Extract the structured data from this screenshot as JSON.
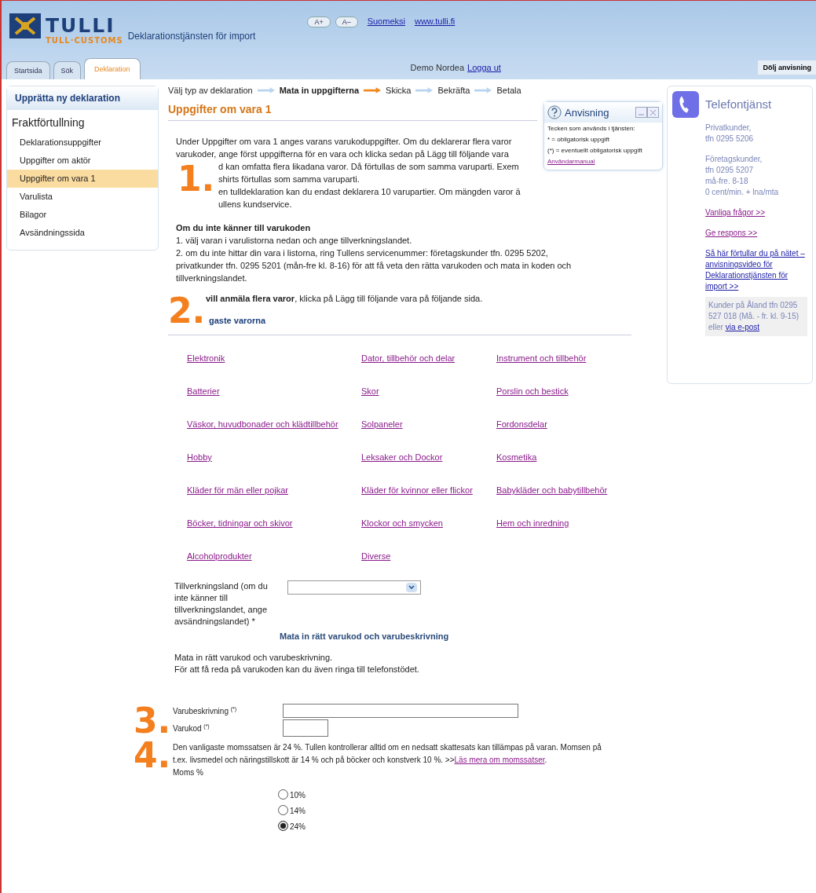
{
  "header": {
    "brand": "TULLI",
    "subbrand": "TULL·CUSTOMS",
    "service": "Deklarationstjänsten för import",
    "font_buttons": [
      "A+",
      "A–"
    ],
    "links": [
      "Suomeksi",
      "www.tulli.fi"
    ]
  },
  "tabs": [
    {
      "label": "Startsida",
      "selected": false
    },
    {
      "label": "Sök",
      "selected": false
    },
    {
      "label": "Deklaration",
      "selected": true
    }
  ],
  "user": {
    "name": "Demo Nordea",
    "logout": "Logga ut"
  },
  "hide_help": "Dölj anvisning",
  "sidebar": {
    "heading": "Upprätta ny deklaration",
    "group": "Fraktförtullning",
    "items": [
      {
        "label": "Deklarationsuppgifter",
        "selected": false
      },
      {
        "label": "Uppgifter om aktör",
        "selected": false
      },
      {
        "label": "Uppgifter om vara 1",
        "selected": true
      },
      {
        "label": "Varulista",
        "selected": false
      },
      {
        "label": "Bilagor",
        "selected": false
      },
      {
        "label": "Avsändningssida",
        "selected": false
      }
    ]
  },
  "steps": [
    {
      "label": "Välj typ av deklaration",
      "selected": false
    },
    {
      "label": "Mata in uppgifterna",
      "selected": true
    },
    {
      "label": "Skicka",
      "selected": false
    },
    {
      "label": "Bekräfta",
      "selected": false
    },
    {
      "label": "Betala",
      "selected": false
    }
  ],
  "title": "Uppgifter om vara 1",
  "intro_lines": [
    {
      "text": "Under Uppgifter om vara 1 anges varans varukoduppgifter. Om du deklarerar flera varor",
      "kind": "full"
    },
    {
      "text": "varukoder, ange först uppgifterna för en vara och klicka sedan på Lägg till följande vara",
      "kind": "full"
    },
    {
      "text": "d kan omfatta flera likadana varor. Då förtullas de som samma varuparti. Exem",
      "kind": "partial"
    },
    {
      "text": "shirts förtullas som samma varuparti.",
      "kind": "partial"
    },
    {
      "text": "en tulldeklaration kan du endast deklarera 10 varupartier. Om mängden varor ä",
      "kind": "partial"
    },
    {
      "text": "ullens kundservice.",
      "kind": "partial"
    }
  ],
  "markers": [
    "1.",
    "2.",
    "3.",
    "4."
  ],
  "unknown_code": {
    "heading": "Om du inte känner till varukoden",
    "lines": [
      "1. välj varan i varulistorna nedan och ange tillverkningslandet.",
      "2. om du inte hittar din vara i listorna, ring Tullens servicenummer: företagskunder tfn. 0295 5202,",
      "privatkunder tfn. 0295 5201 (mån-fre kl. 8-16) för att få veta den rätta varukoden och mata in koden och",
      "tillverkningslandet."
    ]
  },
  "several_goods": "**vill anmäla flera varor**, klicka på Lägg till följande vara på följande sida.",
  "common_heading": "gaste varorna",
  "categories": [
    [
      "Elektronik",
      "Dator, tillbehör och delar",
      "Instrument och tillbehör"
    ],
    [
      "Batterier",
      "Skor",
      "Porslin och bestick"
    ],
    [
      "Väskor, huvudbonader och klädtillbehör",
      "Solpaneler",
      "Fordonsdelar"
    ],
    [
      "Hobby",
      "Leksaker och Dockor",
      "Kosmetika"
    ],
    [
      "Kläder för män eller pojkar",
      "Kläder för kvinnor eller flickor",
      "Babykläder och babytillbehör"
    ],
    [
      "Böcker, tidningar och skivor",
      "Klockor och smycken",
      "Hem och inredning"
    ],
    [
      "Alcoholprodukter",
      "Diverse"
    ]
  ],
  "country_label": "Tillverkningsland (om du inte känner till tillverkningslandet, ange avsändningslandet) *",
  "enter_heading": "Mata in rätt varukod och varubeskrivning",
  "enter_lines": [
    "Mata in rätt varukod och varubeskrivning.",
    "För att få reda på varukoden kan du även ringa till telefonstödet."
  ],
  "fields": [
    {
      "label": "Varubeskrivning",
      "mark": "(*)",
      "kind": "wide"
    },
    {
      "label": "Varukod",
      "mark": "(*)",
      "kind": "short"
    }
  ],
  "vat_text": "Den vanligaste momssatsen är 24 %. Tullen kontrollerar alltid om en nedsatt skattesats kan tillämpas på varan. Momsen på t.ex. livsmedel och näringstillskott är 14 % och på böcker och konstverk 10 %. >>",
  "vat_link": "Läs mera om momssatser",
  "vat_end": ".",
  "vat_label": "Moms %",
  "vat_options": [
    {
      "label": "10%",
      "selected": false
    },
    {
      "label": "14%",
      "selected": false
    },
    {
      "label": "24%",
      "selected": true
    }
  ],
  "help": {
    "title": "Anvisning",
    "lines": [
      "Tecken som används i tjänsten:",
      "* = obligatorisk uppgift",
      "(*) = eventuellt obligatorisk uppgift"
    ],
    "link": "Användarmanual"
  },
  "phone": {
    "title": "Telefontjänst",
    "blocks": [
      "Privatkunder,\ntfn  0295 5206",
      "Företagskunder,\ntfn  0295 5207\nmå-fre. 8-18\n0 cent/min. + lna/mta"
    ],
    "links": [
      "Vanliga frågor >>",
      "Ge respons >>",
      "Så här förtullar du på nätet – anvisningsvideo för Deklarationstjänsten för import >>"
    ],
    "aland": "Kunder på Åland tfn 0295 527 018 (Må. - fr. kl. 9-15) eller",
    "aland_link": "via e-post"
  }
}
